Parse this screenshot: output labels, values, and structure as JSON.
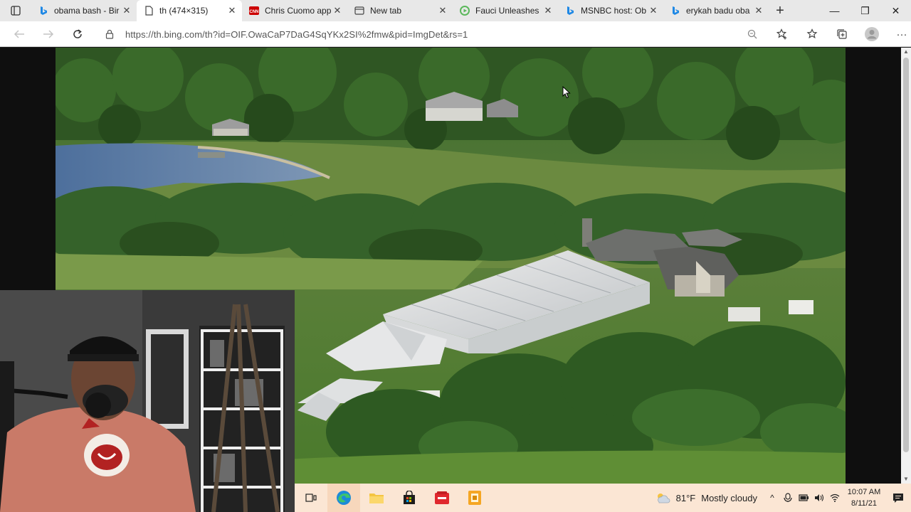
{
  "browser": {
    "tabs": [
      {
        "label": "obama bash - Bir",
        "icon": "bing-icon",
        "active": false
      },
      {
        "label": "th (474×315)",
        "icon": "page-icon",
        "active": true
      },
      {
        "label": "Chris Cuomo app",
        "icon": "cnn-icon",
        "active": false
      },
      {
        "label": "New tab",
        "icon": "newtab-icon",
        "active": false
      },
      {
        "label": "Fauci Unleashes",
        "icon": "rumble-icon",
        "active": false
      },
      {
        "label": "MSNBC host: Ob",
        "icon": "bing-icon",
        "active": false
      },
      {
        "label": "erykah badu oba",
        "icon": "bing-icon",
        "active": false
      }
    ],
    "new_tab": "+",
    "url": "https://th.bing.com/th?id=OIF.OwaCaP7DaG4SqYKx2SI%2fmw&pid=ImgDet&rs=1",
    "colors": {
      "tabstrip": "#e8e8e8",
      "taskbar": "#fbe6d4",
      "content_bg": "#0f0f0f"
    }
  },
  "image": {
    "description_icon": "aerial-estate-photo"
  },
  "taskbar": {
    "weather_temp": "81°F",
    "weather_text": "Mostly cloudy",
    "time": "10:07 AM",
    "date": "8/11/21"
  }
}
